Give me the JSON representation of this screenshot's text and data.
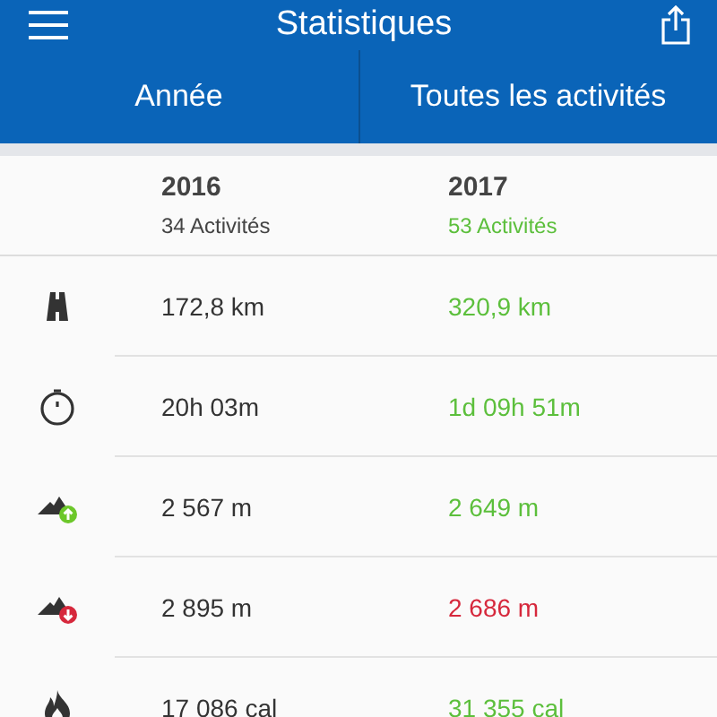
{
  "window": {
    "title": "Statistiques"
  },
  "tabs": [
    {
      "label": "Année"
    },
    {
      "label": "Toutes les activités"
    }
  ],
  "columns": [
    {
      "year": "2016",
      "count": "34 Activités",
      "color": "#444444"
    },
    {
      "year": "2017",
      "count": "53 Activités",
      "color": "#5cbf3c"
    }
  ],
  "rows": [
    {
      "kind": "distance",
      "values": [
        {
          "text": "172,8 km",
          "color": "#333333"
        },
        {
          "text": "320,9 km",
          "color": "#5cbf3c"
        }
      ]
    },
    {
      "kind": "duration",
      "values": [
        {
          "text": "20h 03m",
          "color": "#333333"
        },
        {
          "text": "1d 09h 51m",
          "color": "#5cbf3c"
        }
      ]
    },
    {
      "kind": "ascent",
      "values": [
        {
          "text": "2 567 m",
          "color": "#333333"
        },
        {
          "text": "2 649 m",
          "color": "#5cbf3c"
        }
      ]
    },
    {
      "kind": "descent",
      "values": [
        {
          "text": "2 895 m",
          "color": "#333333"
        },
        {
          "text": "2 686 m",
          "color": "#d6283c"
        }
      ]
    },
    {
      "kind": "calories",
      "values": [
        {
          "text": "17 086 cal",
          "color": "#333333"
        },
        {
          "text": "31 355 cal",
          "color": "#5cbf3c"
        }
      ]
    }
  ]
}
